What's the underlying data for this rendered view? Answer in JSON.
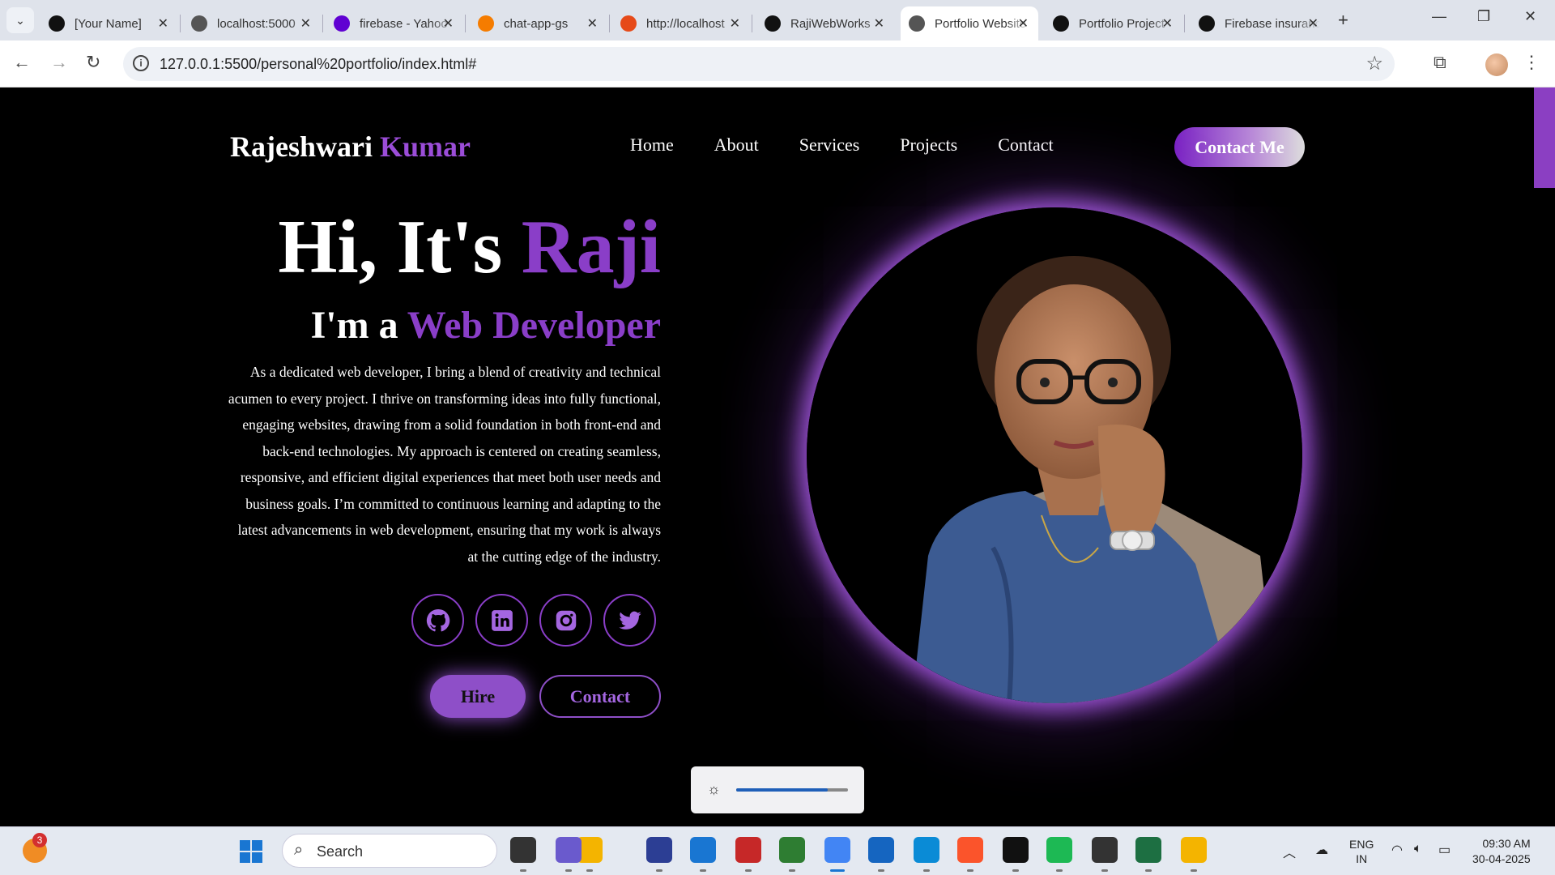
{
  "browser": {
    "tabs": [
      {
        "title": "[Your Name]",
        "icon": "triangle-logo-icon",
        "color": "#111111"
      },
      {
        "title": "localhost:5000",
        "icon": "globe-icon",
        "color": "#555555"
      },
      {
        "title": "firebase - Yahoo",
        "icon": "yahoo-icon",
        "color": "#6001d2"
      },
      {
        "title": "chat-app-gs",
        "icon": "firebase-icon",
        "color": "#f57c00"
      },
      {
        "title": "http://localhost",
        "icon": "loading-icon",
        "color": "#e64a19"
      },
      {
        "title": "RajiWebWorks",
        "icon": "github-icon",
        "color": "#111111"
      },
      {
        "title": "Portfolio Website",
        "icon": "globe-icon",
        "color": "#555555"
      },
      {
        "title": "Portfolio Project",
        "icon": "notion-icon",
        "color": "#111111"
      },
      {
        "title": "Firebase insurance",
        "icon": "openai-icon",
        "color": "#111111"
      }
    ],
    "active_tab": 6,
    "url": "127.0.0.1:5500/personal%20portfolio/index.html#"
  },
  "page": {
    "logo_first": "Rajeshwari ",
    "logo_last": "Kumar",
    "nav": [
      "Home",
      "About",
      "Services",
      "Projects",
      "Contact"
    ],
    "contact_me_label": "Contact Me",
    "greeting": "Hi, It's ",
    "name": "Raji",
    "role_prefix": "I'm a ",
    "role": "Web Developer",
    "description": "As a dedicated web developer, I bring a blend of creativity and technical acumen to every project. I thrive on transforming ideas into fully functional, engaging websites, drawing from a solid foundation in both front-end and back-end technologies. My approach is centered on creating seamless, responsive, and efficient digital experiences that meet both user needs and business goals. I’m committed to continuous learning and adapting to the latest advancements in web development, ensuring that my work is always at the cutting edge of the industry.",
    "socials": [
      "github-icon",
      "linkedin-icon",
      "instagram-icon",
      "twitter-icon"
    ],
    "hire_label": "Hire",
    "contact_label": "Contact",
    "accent_color": "#8a3ec8"
  },
  "brightness": {
    "level": 0.82
  },
  "taskbar": {
    "widget_badge": "3",
    "search_placeholder": "Search",
    "language": "ENG",
    "region": "IN",
    "time": "09:30 AM",
    "date": "30-04-2025"
  }
}
